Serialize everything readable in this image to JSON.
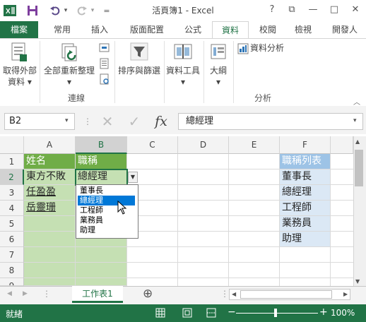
{
  "window": {
    "title": "活頁簿1 - Excel",
    "help": "?",
    "restore_ribbon": "⧉",
    "minimize": "—",
    "maximize": "□",
    "close": "✕"
  },
  "qat": {
    "undo_arrow": "▾",
    "redo_arrow": "▾",
    "customize": "="
  },
  "tabs": [
    "檔案",
    "常用",
    "插入",
    "版面配置",
    "公式",
    "資料",
    "校閱",
    "檢視",
    "開發人"
  ],
  "ribbon": {
    "get_external_line1": "取得外部",
    "get_external_line2": "資料 ▾",
    "refresh_all_line1": "全部重新整理",
    "refresh_all_line2": "▾",
    "sort_filter": "排序與篩選",
    "data_tools_line1": "資料工具",
    "data_tools_line2": "▾",
    "outline_line1": "大綱",
    "outline_line2": "▾",
    "data_analysis": "資料分析",
    "group_connections": "連線",
    "group_analysis": "分析"
  },
  "formula_bar": {
    "name_box": "B2",
    "cancel": "✕",
    "enter": "✓",
    "fx": "fx",
    "content": "總經理"
  },
  "grid": {
    "columns": [
      "A",
      "B",
      "C",
      "D",
      "E",
      "F"
    ],
    "rows": [
      "1",
      "2",
      "3",
      "4",
      "5",
      "6",
      "7",
      "8",
      "9"
    ],
    "A": [
      "姓名",
      "東方不敗",
      "任盈盈",
      "岳靈珊"
    ],
    "B": [
      "職稱",
      "總經理"
    ],
    "F": [
      "職稱列表",
      "董事長",
      "總經理",
      "工程師",
      "業務員",
      "助理"
    ]
  },
  "dropdown": {
    "items": [
      "董事長",
      "總經理",
      "工程師",
      "業務員",
      "助理"
    ],
    "selected_index": 1
  },
  "sheet": {
    "tab": "工作表1",
    "add": "⊕",
    "nav_prev": "◀",
    "nav_next": "▶",
    "more": "⋮"
  },
  "status": {
    "ready": "就緒",
    "zoom_minus": "−",
    "zoom_plus": "+",
    "zoom": "100%"
  },
  "colors": {
    "excel_green": "#217346",
    "header_green": "#70ad47",
    "cell_green": "#c5e0b3",
    "header_blue": "#9dc3e6",
    "cell_blue": "#dbe8f5",
    "select_blue": "#0078d7"
  }
}
